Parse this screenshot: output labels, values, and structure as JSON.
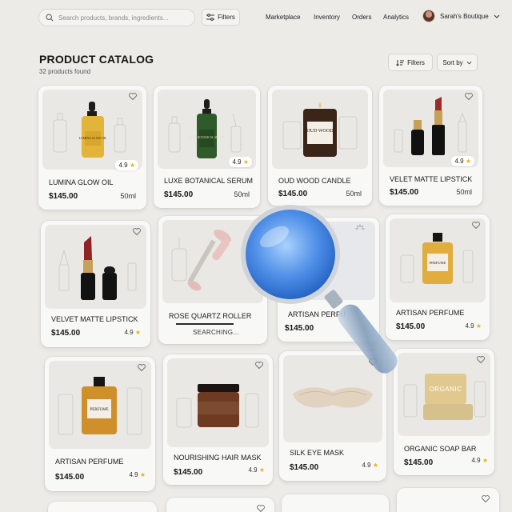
{
  "search": {
    "placeholder": "Search products, brands, ingredients..."
  },
  "topbar": {
    "filters_label": "Filters"
  },
  "nav": {
    "items": [
      "Marketplace",
      "Inventory",
      "Orders",
      "Analytics"
    ]
  },
  "account": {
    "name": "Sarah's Boutique"
  },
  "page": {
    "title": "PRODUCT CATALOG",
    "count": "32 products found",
    "filters_label": "Filters",
    "sort_label": "Sort by"
  },
  "colors": {
    "background": "#ecebe8",
    "star": "#e8b318",
    "lens": "#3f86e8"
  },
  "products": [
    {
      "name": "LUMINA GLOW OIL",
      "price": "$145.00",
      "volume": "50ml",
      "rating": "4.9",
      "bottle_text": "LUMINA GLOW OIL"
    },
    {
      "name": "LUXE BOTANICAL SERUM",
      "price": "$145.00",
      "volume": "50ml",
      "rating": "4.9",
      "bottle_text": "LUXE BOTANICAL SERUM"
    },
    {
      "name": "OUD WOOD CANDLE",
      "price": "$145.00",
      "volume": "50ml",
      "bottle_text": "OUD WOOD"
    },
    {
      "name": "VELET MATTE LIPSTICK",
      "price": "$145.00",
      "volume": "50ml",
      "rating": "4.9"
    },
    {
      "name": "VELVET MATTE LIPSTICK",
      "price": "$145.00",
      "rating": "4.9"
    },
    {
      "name": "ROSE QUARTZ ROLLER",
      "status": "SEARCHING..."
    },
    {
      "name": "ARTISAN PERFU",
      "price": "$145.00"
    },
    {
      "name": "ARTISAN PERFUME",
      "price": "$145.00",
      "rating": "4.9",
      "bottle_text": "PERFUME"
    },
    {
      "name": "ARTISAN PERFUME",
      "price": "$145.00",
      "rating": "4.9",
      "bottle_text": "PERFUME"
    },
    {
      "name": "NOURISHING HAIR MASK",
      "price": "$145.00",
      "rating": "4.9"
    },
    {
      "name": "SILK EYE MASK",
      "price": "$145.00",
      "rating": "4.9"
    },
    {
      "name": "ORGANIC SOAP BAR",
      "price": "$145.00",
      "rating": "4.9",
      "bottle_text": "ORGANIC"
    }
  ]
}
